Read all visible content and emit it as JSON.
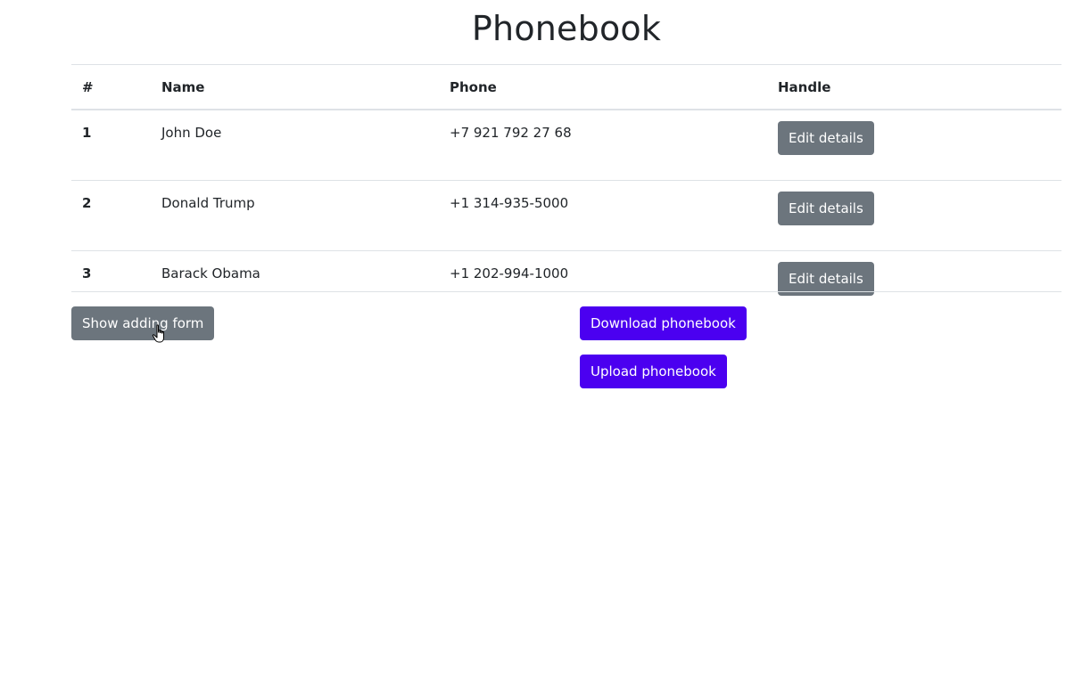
{
  "page": {
    "title": "Phonebook"
  },
  "table": {
    "headers": [
      "#",
      "Name",
      "Phone",
      "Handle"
    ],
    "rows": [
      {
        "num": "1",
        "name": "John Doe",
        "phone": "+7 921 792 27 68",
        "action": "Edit details"
      },
      {
        "num": "2",
        "name": "Donald Trump",
        "phone": "+1 314-935-5000",
        "action": "Edit details"
      },
      {
        "num": "3",
        "name": "Barack Obama",
        "phone": "+1 202-994-1000",
        "action": "Edit details"
      }
    ]
  },
  "actions": {
    "show_form": "Show adding form",
    "download": "Download phonebook",
    "upload": "Upload phonebook"
  },
  "colors": {
    "secondary": "#6c757d",
    "primary": "#4b00f0"
  },
  "icons": {
    "cursor": "hand-pointer-cursor-icon"
  }
}
